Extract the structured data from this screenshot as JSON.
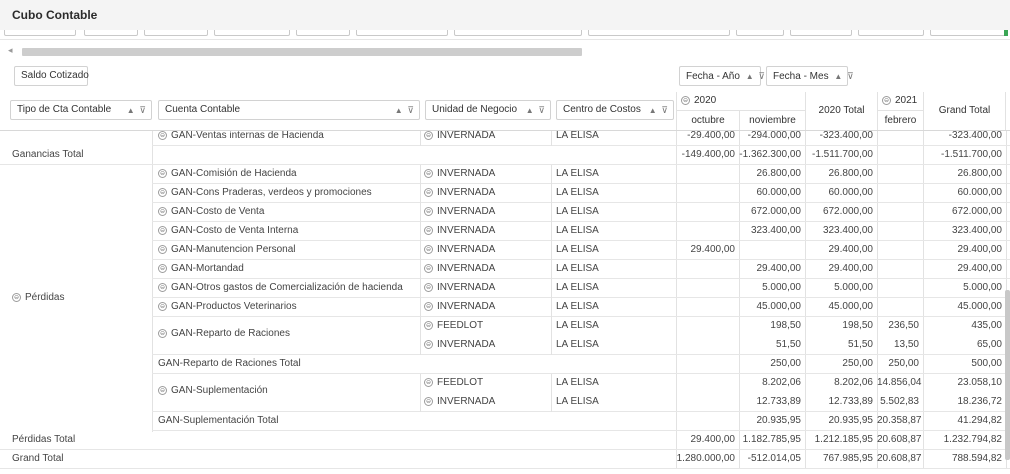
{
  "app": {
    "title": "Cubo Contable"
  },
  "toolbar": {
    "data_field": "Saldo Cotizado",
    "col_fields": [
      {
        "label": "Fecha - Año",
        "sort": "▲",
        "filter": "⊽"
      },
      {
        "label": "Fecha - Mes",
        "sort": "▲",
        "filter": "⊽"
      }
    ],
    "row_fields": [
      {
        "label": "Tipo de Cta Contable",
        "sort": "▲",
        "filter": "⊽"
      },
      {
        "label": "Cuenta Contable",
        "sort": "▲",
        "filter": "⊽"
      },
      {
        "label": "Unidad de Negocio",
        "sort": "▲",
        "filter": "⊽"
      },
      {
        "label": "Centro de Costos",
        "sort": "▲",
        "filter": "⊽"
      }
    ]
  },
  "columns": {
    "year_2020": "2020",
    "months_2020": [
      "octubre",
      "noviembre"
    ],
    "total_2020": "2020 Total",
    "year_2021": "2021",
    "months_2021": [
      "febrero"
    ],
    "grand_total": "Grand Total",
    "expand_glyph": "⊖"
  },
  "groups": {
    "ganancias_total": "Ganancias Total",
    "perdidas": "Pérdidas",
    "perdidas_total": "Pérdidas Total",
    "grand_total": "Grand Total"
  },
  "rows": [
    {
      "kind": "leaf",
      "account": "GAN-Ventas internas de Hacienda",
      "unit": "INVERNADA",
      "center": "LA ELISA",
      "values": [
        "-29.400,00",
        "-294.000,00",
        "-323.400,00",
        "",
        "-323.400,00"
      ]
    },
    {
      "kind": "total",
      "label": "Ganancias Total",
      "values": [
        "-149.400,00",
        "-1.362.300,00",
        "-1.511.700,00",
        "",
        "-1.511.700,00"
      ]
    },
    {
      "kind": "leaf",
      "account": "GAN-Comisión de Hacienda",
      "unit": "INVERNADA",
      "center": "LA ELISA",
      "values": [
        "",
        "26.800,00",
        "26.800,00",
        "",
        "26.800,00"
      ]
    },
    {
      "kind": "leaf",
      "account": "GAN-Cons Praderas, verdeos y promociones",
      "unit": "INVERNADA",
      "center": "LA ELISA",
      "values": [
        "",
        "60.000,00",
        "60.000,00",
        "",
        "60.000,00"
      ]
    },
    {
      "kind": "leaf",
      "account": "GAN-Costo de Venta",
      "unit": "INVERNADA",
      "center": "LA ELISA",
      "values": [
        "",
        "672.000,00",
        "672.000,00",
        "",
        "672.000,00"
      ]
    },
    {
      "kind": "leaf",
      "account": "GAN-Costo de Venta Interna",
      "unit": "INVERNADA",
      "center": "LA ELISA",
      "values": [
        "",
        "323.400,00",
        "323.400,00",
        "",
        "323.400,00"
      ]
    },
    {
      "kind": "leaf",
      "account": "GAN-Manutencion Personal",
      "unit": "INVERNADA",
      "center": "LA ELISA",
      "values": [
        "29.400,00",
        "",
        "29.400,00",
        "",
        "29.400,00"
      ]
    },
    {
      "kind": "leaf",
      "account": "GAN-Mortandad",
      "unit": "INVERNADA",
      "center": "LA ELISA",
      "values": [
        "",
        "29.400,00",
        "29.400,00",
        "",
        "29.400,00"
      ]
    },
    {
      "kind": "leaf",
      "account": "GAN-Otros gastos de Comercialización de hacienda",
      "unit": "INVERNADA",
      "center": "LA ELISA",
      "values": [
        "",
        "5.000,00",
        "5.000,00",
        "",
        "5.000,00"
      ]
    },
    {
      "kind": "leaf",
      "account": "GAN-Productos Veterinarios",
      "unit": "INVERNADA",
      "center": "LA ELISA",
      "values": [
        "",
        "45.000,00",
        "45.000,00",
        "",
        "45.000,00"
      ]
    },
    {
      "kind": "leaf",
      "account": "GAN-Reparto de Raciones",
      "unit": "FEEDLOT",
      "center": "LA ELISA",
      "values": [
        "",
        "198,50",
        "198,50",
        "236,50",
        "435,00"
      ]
    },
    {
      "kind": "leaf-cont",
      "unit": "INVERNADA",
      "center": "LA ELISA",
      "values": [
        "",
        "51,50",
        "51,50",
        "13,50",
        "65,00"
      ]
    },
    {
      "kind": "subtotal",
      "label": "GAN-Reparto de Raciones Total",
      "values": [
        "",
        "250,00",
        "250,00",
        "250,00",
        "500,00"
      ]
    },
    {
      "kind": "leaf",
      "account": "GAN-Suplementación",
      "unit": "FEEDLOT",
      "center": "LA ELISA",
      "values": [
        "",
        "8.202,06",
        "8.202,06",
        "14.856,04",
        "23.058,10"
      ]
    },
    {
      "kind": "leaf-cont",
      "unit": "INVERNADA",
      "center": "LA ELISA",
      "values": [
        "",
        "12.733,89",
        "12.733,89",
        "5.502,83",
        "18.236,72"
      ]
    },
    {
      "kind": "subtotal",
      "label": "GAN-Suplementación Total",
      "values": [
        "",
        "20.935,95",
        "20.935,95",
        "20.358,87",
        "41.294,82"
      ]
    },
    {
      "kind": "total",
      "label": "Pérdidas Total",
      "values": [
        "29.400,00",
        "1.182.785,95",
        "1.212.185,95",
        "20.608,87",
        "1.232.794,82"
      ]
    },
    {
      "kind": "total",
      "label": "Grand Total",
      "values": [
        "1.280.000,00",
        "-512.014,05",
        "767.985,95",
        "20.608,87",
        "788.594,82"
      ]
    }
  ]
}
